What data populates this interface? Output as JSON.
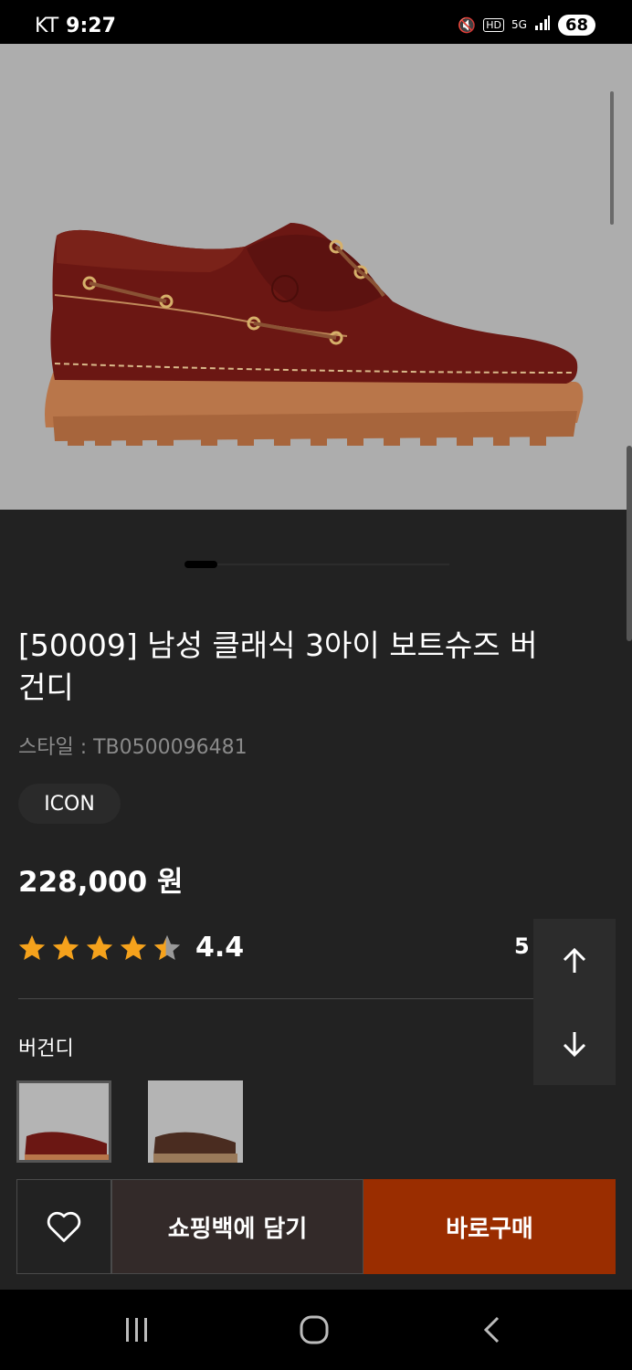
{
  "status": {
    "carrier": "KT",
    "time": "9:27",
    "network": "5G",
    "hd": "HD",
    "battery": "68"
  },
  "product": {
    "title": "[50009] 남성 클래식 3아이 보트슈즈 버건디",
    "style": "스타일 : TB0500096481",
    "badge": "ICON",
    "price": "228,000 원",
    "rating": {
      "value": "4.4",
      "stars": 4.4,
      "review_count_partial": "5 i"
    },
    "color_label": "버건디"
  },
  "gallery": {
    "total_pages_fraction": 0.12
  },
  "actions": {
    "wishlist_icon": "heart-icon",
    "add_to_bag": "쇼핑백에 담기",
    "buy_now": "바로구매"
  },
  "colors": {
    "background": "#222222",
    "accent_buy": "#9a2d00",
    "star": "#f5a21c",
    "star_empty": "#999999"
  }
}
